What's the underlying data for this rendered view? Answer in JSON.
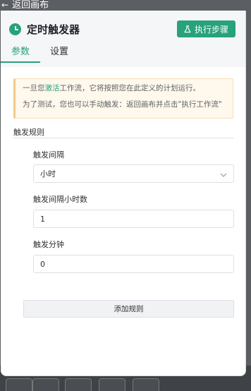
{
  "back": {
    "label": "返回画布"
  },
  "panel": {
    "title": "定时触发器",
    "execute_button": "执行步骤",
    "tabs": [
      {
        "label": "参数",
        "active": true
      },
      {
        "label": "设置",
        "active": false
      }
    ]
  },
  "notice": {
    "line1_before": "一旦您",
    "line1_highlight": "激活",
    "line1_after": "工作流，它将按照您在此定义的计划运行。",
    "line2": "为了测试，您也可以手动触发：返回画布并点击\"执行工作流\""
  },
  "rules": {
    "section_title": "触发规则",
    "interval_label": "触发间隔",
    "interval_value": "小时",
    "hours_label": "触发间隔小时数",
    "hours_value": "1",
    "minute_label": "触发分钟",
    "minute_value": "0",
    "add_button": "添加规则"
  },
  "colors": {
    "accent": "#27a27b",
    "notice_bg": "#fff8ec",
    "overlay_bg": "#5b5e63"
  },
  "icons": {
    "back": "arrow-left-icon",
    "title": "clock-icon",
    "execute": "flask-icon",
    "select": "chevron-down-icon"
  }
}
